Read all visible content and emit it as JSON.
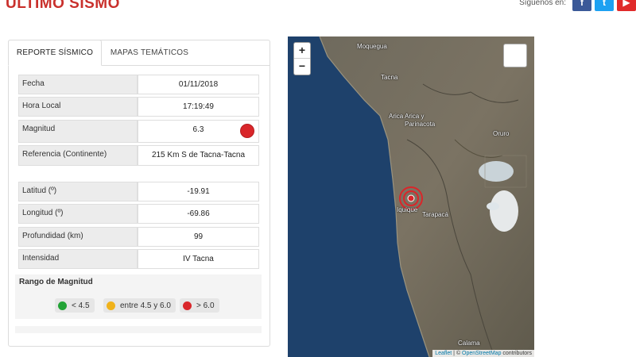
{
  "header": {
    "title": "ÚLTIMO SISMO",
    "social_label": "Síguenos en:",
    "social": {
      "facebook": "f",
      "twitter": "t",
      "youtube": "▶"
    }
  },
  "tabs": {
    "report": "REPORTE SÍSMICO",
    "maps": "MAPAS TEMÁTICOS"
  },
  "report": {
    "fecha": {
      "label": "Fecha",
      "value": "01/11/2018"
    },
    "hora": {
      "label": "Hora Local",
      "value": "17:19:49"
    },
    "magnitud": {
      "label": "Magnitud",
      "value": "6.3",
      "color": "#d9262a"
    },
    "referencia": {
      "label": "Referencia (Continente)",
      "value": "215 Km S de Tacna-Tacna"
    },
    "latitud": {
      "label": "Latitud (º)",
      "value": "-19.91"
    },
    "longitud": {
      "label": "Longitud (º)",
      "value": "-69.86"
    },
    "profundidad": {
      "label": "Profundidad (km)",
      "value": "99"
    },
    "intensidad": {
      "label": "Intensidad",
      "value": "IV Tacna"
    }
  },
  "range": {
    "title": "Rango de Magnitud",
    "low": {
      "label": "< 4.5",
      "color": "#22a336"
    },
    "mid": {
      "label": "entre 4.5 y 6.0",
      "color": "#f0b21b"
    },
    "high": {
      "label": "> 6.0",
      "color": "#d9262a"
    }
  },
  "map": {
    "zoom_in": "+",
    "zoom_out": "−",
    "labels": {
      "moquegua": "Moquegua",
      "tacna": "Tacna",
      "arica": "Arica",
      "arica_parinacota": "Arica y Parinacota",
      "oruro": "Oruro",
      "iquique": "Iquique",
      "tarapaca": "Tarapacá",
      "calama": "Calama"
    },
    "attribution_leaflet": "Leaflet",
    "attribution_sep": " | © ",
    "attribution_osm": "OpenStreetMap",
    "attribution_tail": " contributors"
  }
}
